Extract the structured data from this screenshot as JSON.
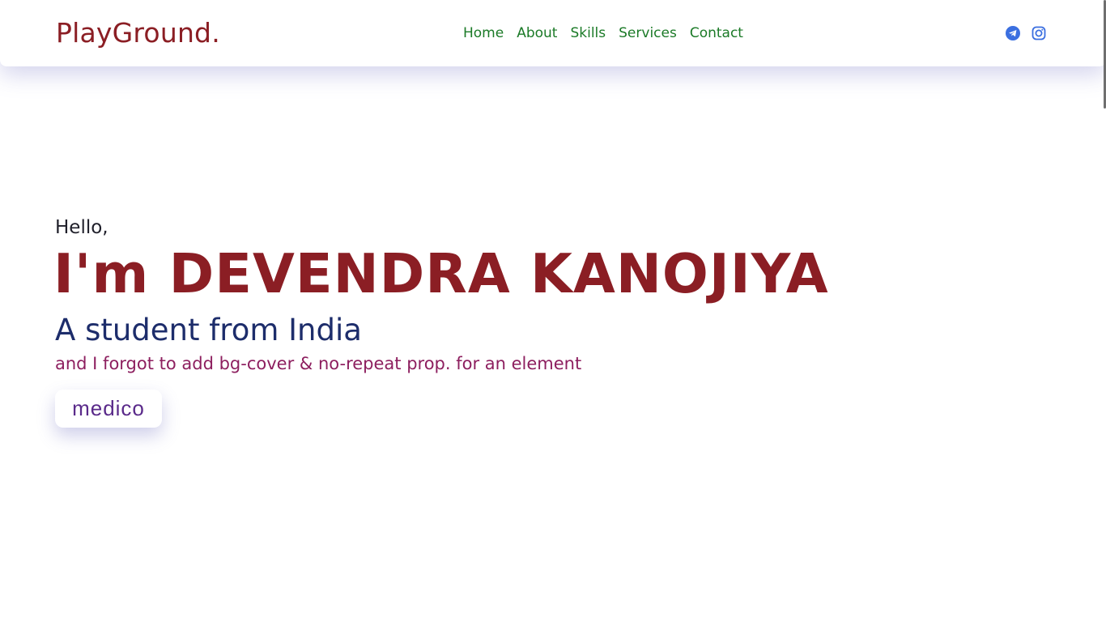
{
  "navbar": {
    "brand": "PlayGround.",
    "links": [
      {
        "label": "Home"
      },
      {
        "label": "About"
      },
      {
        "label": "Skills"
      },
      {
        "label": "Services"
      },
      {
        "label": "Contact"
      }
    ],
    "social_icons": [
      "telegram-icon",
      "instagram-icon"
    ],
    "accent_color": "#3b6fe0",
    "brand_color": "#8b1e24",
    "link_color": "#1b7a27"
  },
  "hero": {
    "greeting": "Hello,",
    "name": "I'm DEVENDRA KANOJIYA",
    "tagline": "A student from India",
    "subtitle": "and I forgot to add bg-cover & no-repeat prop. for an element",
    "button_label": "medico",
    "name_color": "#8b1e24",
    "tagline_color": "#1d2d6b",
    "subtitle_color": "#8d1f5f"
  }
}
